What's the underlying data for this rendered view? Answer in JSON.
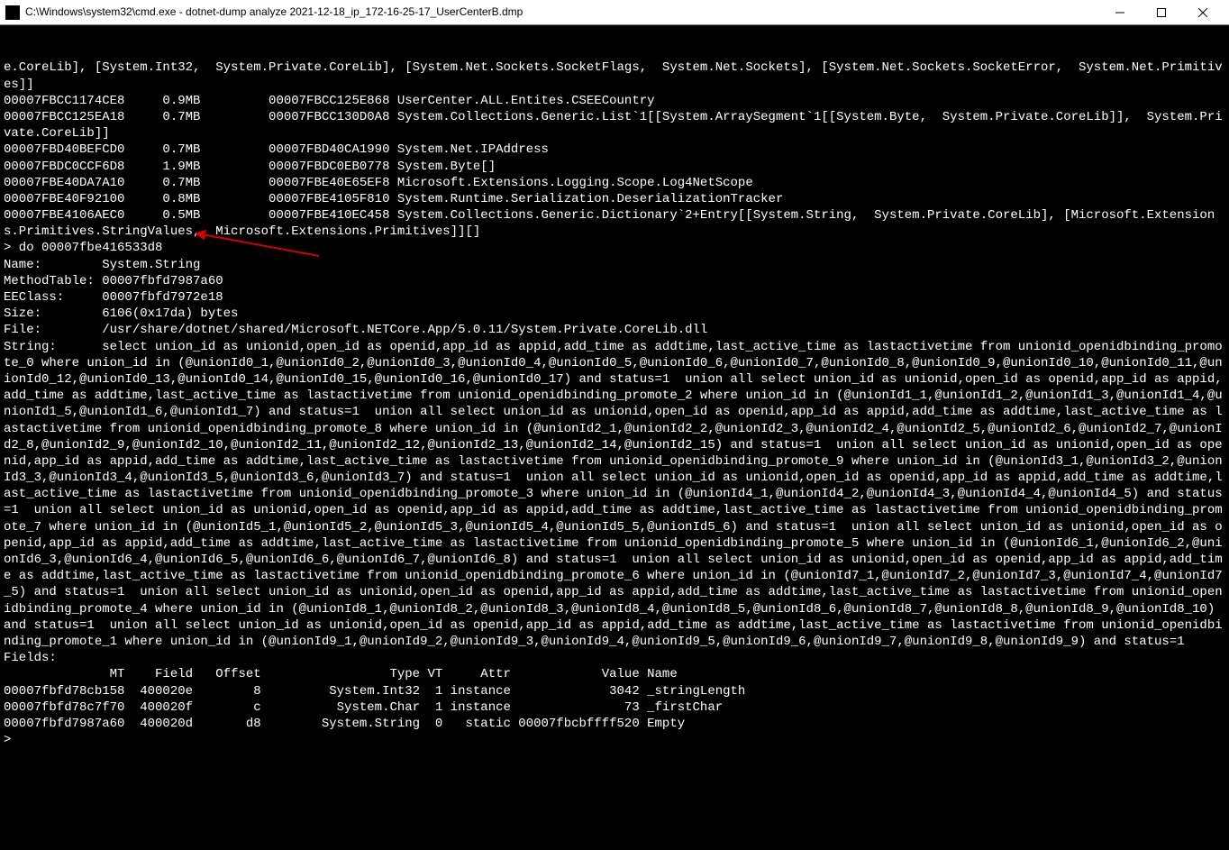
{
  "titlebar": {
    "title": "C:\\Windows\\system32\\cmd.exe - dotnet-dump  analyze 2021-12-18_ip_172-16-25-17_UserCenterB.dmp"
  },
  "terminal": {
    "lines": [
      "e.CoreLib], [System.Int32,  System.Private.CoreLib], [System.Net.Sockets.SocketFlags,  System.Net.Sockets], [System.Net.Sockets.SocketError,  System.Net.Primitives]]",
      "00007FBCC1174CE8     0.9MB         00007FBCC125E868 UserCenter.ALL.Entites.CSEECountry",
      "00007FBCC125EA18     0.7MB         00007FBCC130D0A8 System.Collections.Generic.List`1[[System.ArraySegment`1[[System.Byte,  System.Private.CoreLib]],  System.Private.CoreLib]]",
      "00007FBD40BEFCD0     0.7MB         00007FBD40CA1990 System.Net.IPAddress",
      "00007FBDC0CCF6D8     1.9MB         00007FBDC0EB0778 System.Byte[]",
      "00007FBE40DA7A10     0.7MB         00007FBE40E65EF8 Microsoft.Extensions.Logging.Scope.Log4NetScope",
      "00007FBE40F92100     0.8MB         00007FBE4105F810 System.Runtime.Serialization.DeserializationTracker",
      "00007FBE4106AEC0     0.5MB         00007FBE410EC458 System.Collections.Generic.Dictionary`2+Entry[[System.String,  System.Private.CoreLib], [Microsoft.Extensions.Primitives.StringValues,  Microsoft.Extensions.Primitives]][]",
      "> do 00007fbe416533d8",
      "Name:        System.String",
      "MethodTable: 00007fbfd7987a60",
      "EEClass:     00007fbfd7972e18",
      "Size:        6106(0x17da) bytes",
      "File:        /usr/share/dotnet/shared/Microsoft.NETCore.App/5.0.11/System.Private.CoreLib.dll",
      "String:      select union_id as unionid,open_id as openid,app_id as appid,add_time as addtime,last_active_time as lastactivetime from unionid_openidbinding_promote_0 where union_id in (@unionId0_1,@unionId0_2,@unionId0_3,@unionId0_4,@unionId0_5,@unionId0_6,@unionId0_7,@unionId0_8,@unionId0_9,@unionId0_10,@unionId0_11,@unionId0_12,@unionId0_13,@unionId0_14,@unionId0_15,@unionId0_16,@unionId0_17) and status=1  union all select union_id as unionid,open_id as openid,app_id as appid,add_time as addtime,last_active_time as lastactivetime from unionid_openidbinding_promote_2 where union_id in (@unionId1_1,@unionId1_2,@unionId1_3,@unionId1_4,@unionId1_5,@unionId1_6,@unionId1_7) and status=1  union all select union_id as unionid,open_id as openid,app_id as appid,add_time as addtime,last_active_time as lastactivetime from unionid_openidbinding_promote_8 where union_id in (@unionId2_1,@unionId2_2,@unionId2_3,@unionId2_4,@unionId2_5,@unionId2_6,@unionId2_7,@unionId2_8,@unionId2_9,@unionId2_10,@unionId2_11,@unionId2_12,@unionId2_13,@unionId2_14,@unionId2_15) and status=1  union all select union_id as unionid,open_id as openid,app_id as appid,add_time as addtime,last_active_time as lastactivetime from unionid_openidbinding_promote_9 where union_id in (@unionId3_1,@unionId3_2,@unionId3_3,@unionId3_4,@unionId3_5,@unionId3_6,@unionId3_7) and status=1  union all select union_id as unionid,open_id as openid,app_id as appid,add_time as addtime,last_active_time as lastactivetime from unionid_openidbinding_promote_3 where union_id in (@unionId4_1,@unionId4_2,@unionId4_3,@unionId4_4,@unionId4_5) and status=1  union all select union_id as unionid,open_id as openid,app_id as appid,add_time as addtime,last_active_time as lastactivetime from unionid_openidbinding_promote_7 where union_id in (@unionId5_1,@unionId5_2,@unionId5_3,@unionId5_4,@unionId5_5,@unionId5_6) and status=1  union all select union_id as unionid,open_id as openid,app_id as appid,add_time as addtime,last_active_time as lastactivetime from unionid_openidbinding_promote_5 where union_id in (@unionId6_1,@unionId6_2,@unionId6_3,@unionId6_4,@unionId6_5,@unionId6_6,@unionId6_7,@unionId6_8) and status=1  union all select union_id as unionid,open_id as openid,app_id as appid,add_time as addtime,last_active_time as lastactivetime from unionid_openidbinding_promote_6 where union_id in (@unionId7_1,@unionId7_2,@unionId7_3,@unionId7_4,@unionId7_5) and status=1  union all select union_id as unionid,open_id as openid,app_id as appid,add_time as addtime,last_active_time as lastactivetime from unionid_openidbinding_promote_4 where union_id in (@unionId8_1,@unionId8_2,@unionId8_3,@unionId8_4,@unionId8_5,@unionId8_6,@unionId8_7,@unionId8_8,@unionId8_9,@unionId8_10) and status=1  union all select union_id as unionid,open_id as openid,app_id as appid,add_time as addtime,last_active_time as lastactivetime from unionid_openidbinding_promote_1 where union_id in (@unionId9_1,@unionId9_2,@unionId9_3,@unionId9_4,@unionId9_5,@unionId9_6,@unionId9_7,@unionId9_8,@unionId9_9) and status=1",
      "Fields:",
      "              MT    Field   Offset                 Type VT     Attr            Value Name",
      "00007fbfd78cb158  400020e        8         System.Int32  1 instance             3042 _stringLength",
      "00007fbfd78c7f70  400020f        c          System.Char  1 instance               73 _firstChar",
      "00007fbfd7987a60  400020d       d8        System.String  0   static 00007fbcbffff520 Empty",
      ">"
    ]
  }
}
